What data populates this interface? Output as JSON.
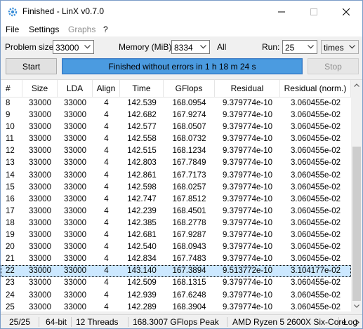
{
  "window": {
    "title": "Finished - LinX v0.7.0"
  },
  "menu": {
    "file": "File",
    "settings": "Settings",
    "graphs": "Graphs",
    "help": "?"
  },
  "controls": {
    "problem_size_label": "Problem size:",
    "problem_size_value": "33000",
    "memory_label": "Memory (MiB):",
    "memory_value": "8334",
    "all_label": "All",
    "run_label": "Run:",
    "run_value": "25",
    "run_unit": "times",
    "start_label": "Start",
    "stop_label": "Stop",
    "status_text": "Finished without errors in 1 h 18 m 24 s",
    "progress": 1.0
  },
  "table": {
    "columns": [
      "#",
      "Size",
      "LDA",
      "Align",
      "Time",
      "GFlops",
      "Residual",
      "Residual (norm.)"
    ],
    "selected_index": 14,
    "rows": [
      [
        "8",
        "33000",
        "33000",
        "4",
        "142.539",
        "168.0954",
        "9.379774e-10",
        "3.060455e-02"
      ],
      [
        "9",
        "33000",
        "33000",
        "4",
        "142.682",
        "167.9274",
        "9.379774e-10",
        "3.060455e-02"
      ],
      [
        "10",
        "33000",
        "33000",
        "4",
        "142.577",
        "168.0507",
        "9.379774e-10",
        "3.060455e-02"
      ],
      [
        "11",
        "33000",
        "33000",
        "4",
        "142.558",
        "168.0732",
        "9.379774e-10",
        "3.060455e-02"
      ],
      [
        "12",
        "33000",
        "33000",
        "4",
        "142.515",
        "168.1234",
        "9.379774e-10",
        "3.060455e-02"
      ],
      [
        "13",
        "33000",
        "33000",
        "4",
        "142.803",
        "167.7849",
        "9.379774e-10",
        "3.060455e-02"
      ],
      [
        "14",
        "33000",
        "33000",
        "4",
        "142.861",
        "167.7173",
        "9.379774e-10",
        "3.060455e-02"
      ],
      [
        "15",
        "33000",
        "33000",
        "4",
        "142.598",
        "168.0257",
        "9.379774e-10",
        "3.060455e-02"
      ],
      [
        "16",
        "33000",
        "33000",
        "4",
        "142.747",
        "167.8512",
        "9.379774e-10",
        "3.060455e-02"
      ],
      [
        "17",
        "33000",
        "33000",
        "4",
        "142.239",
        "168.4501",
        "9.379774e-10",
        "3.060455e-02"
      ],
      [
        "18",
        "33000",
        "33000",
        "4",
        "142.385",
        "168.2778",
        "9.379774e-10",
        "3.060455e-02"
      ],
      [
        "19",
        "33000",
        "33000",
        "4",
        "142.681",
        "167.9287",
        "9.379774e-10",
        "3.060455e-02"
      ],
      [
        "20",
        "33000",
        "33000",
        "4",
        "142.540",
        "168.0943",
        "9.379774e-10",
        "3.060455e-02"
      ],
      [
        "21",
        "33000",
        "33000",
        "4",
        "142.834",
        "167.7483",
        "9.379774e-10",
        "3.060455e-02"
      ],
      [
        "22",
        "33000",
        "33000",
        "4",
        "143.140",
        "167.3894",
        "9.513772e-10",
        "3.104177e-02"
      ],
      [
        "23",
        "33000",
        "33000",
        "4",
        "142.509",
        "168.1315",
        "9.379774e-10",
        "3.060455e-02"
      ],
      [
        "24",
        "33000",
        "33000",
        "4",
        "142.939",
        "167.6248",
        "9.379774e-10",
        "3.060455e-02"
      ],
      [
        "25",
        "33000",
        "33000",
        "4",
        "142.289",
        "168.3904",
        "9.379774e-10",
        "3.060455e-02"
      ]
    ]
  },
  "footer": {
    "runs": "25/25",
    "bits": "64-bit",
    "threads": "12 Threads",
    "peak": "168.3007 GFlops Peak",
    "cpu": "AMD Ryzen 5 2600X Six-Core",
    "log": "Log"
  },
  "colors": {
    "status_fill": "#3d8fd9",
    "selected_row": "#cce8ff"
  },
  "icons": {
    "app": "gear-icon",
    "min": "minimize-icon",
    "max": "maximize-icon",
    "close": "close-icon"
  }
}
